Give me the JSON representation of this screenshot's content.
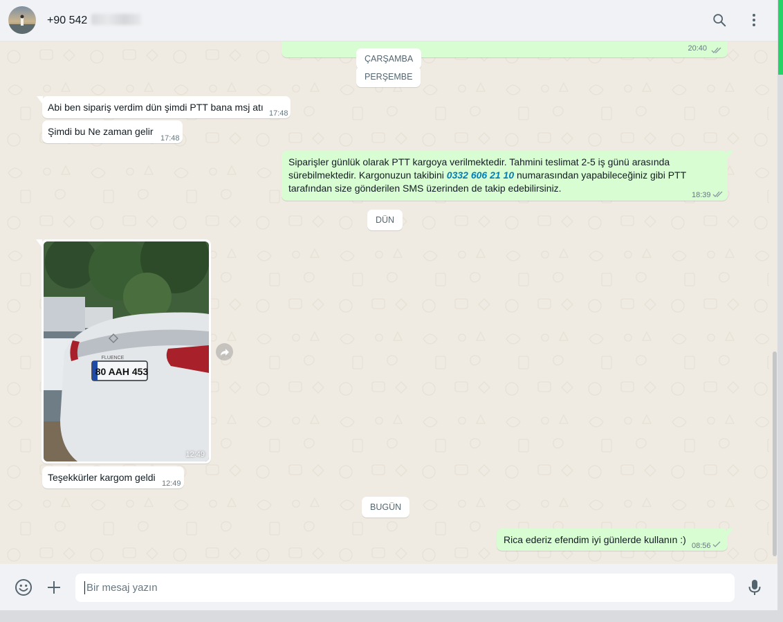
{
  "header": {
    "contact_name": "+90 542",
    "search_icon": "search-icon",
    "menu_icon": "kebab-menu-icon"
  },
  "conversation": {
    "top_partial_time": "20:40",
    "date_chips": {
      "wednesday": "ÇARŞAMBA",
      "thursday": "PERŞEMBE",
      "yesterday": "DÜN",
      "today": "BUGÜN"
    },
    "messages": [
      {
        "direction": "in",
        "text": "Abi ben sipariş verdim dün şimdi PTT bana msj atı",
        "time": "17:48"
      },
      {
        "direction": "in",
        "text": "Şimdi bu Ne zaman gelir",
        "time": "17:48"
      },
      {
        "direction": "out",
        "text_part1": "Siparişler günlük olarak PTT kargoya verilmektedir. Tahmini teslimat 2-5 iş günü arasında sürebilmektedir. Kargonuzun takibini ",
        "phone": "0332 606 21 10",
        "text_part2": " numarasından yapabileceğiniz gibi PTT tarafından size gönderilen SMS üzerinden de takip edebilirsiniz.",
        "time": "18:39",
        "status": "read"
      },
      {
        "direction": "in",
        "type": "image",
        "plate_text": "80 AAH 453",
        "badge_text": "FLUENCE",
        "time": "12:49"
      },
      {
        "direction": "in",
        "text": "Teşekkürler kargom geldi",
        "time": "12:49"
      },
      {
        "direction": "out",
        "text": "Rica ederiz efendim iyi günlerde kullanın :)",
        "time": "08:56",
        "status": "delivered"
      }
    ]
  },
  "footer": {
    "placeholder": "Bir mesaj yazın",
    "emoji_icon": "emoji-icon",
    "attach_icon": "plus-icon",
    "mic_icon": "microphone-icon"
  },
  "colors": {
    "incoming_bubble": "#ffffff",
    "outgoing_bubble": "#d9fdd3",
    "chat_background": "#efeae2",
    "link": "#027eb5",
    "read_tick": "#53bdeb",
    "accent_green": "#25d366"
  }
}
